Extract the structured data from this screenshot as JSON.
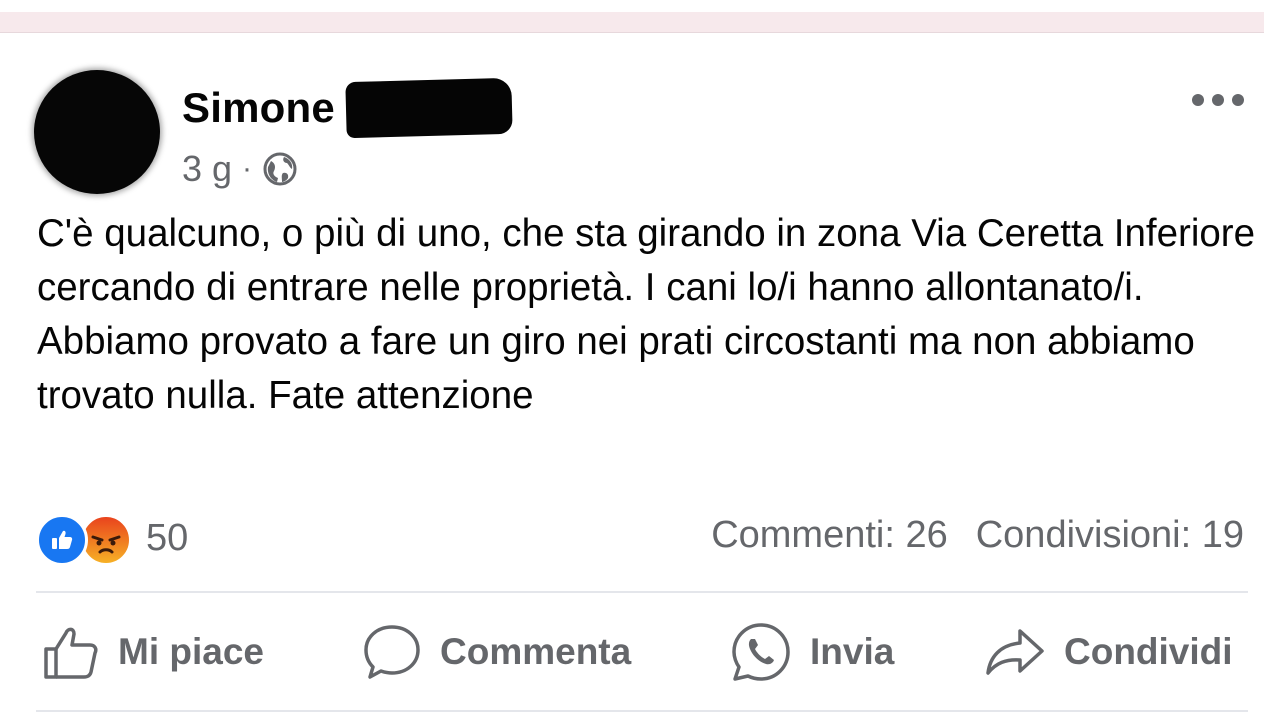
{
  "post": {
    "author_name": "Simone",
    "timestamp": "3 g",
    "separator": "·",
    "audience_icon": "globe-icon",
    "menu_icon": "more-options-icon",
    "text": "C'è qualcuno, o più di uno, che sta girando in zona Via Ceretta Inferiore cercando di entrare nelle proprietà. I cani lo/i hanno allontanato/i. Abbiamo provato a fare un giro nei prati circostanti ma non abbiamo trovato nulla. Fate attenzione"
  },
  "engagement": {
    "reaction_icons": [
      "like-reaction-icon",
      "angry-reaction-icon"
    ],
    "reaction_count": "50",
    "comments": "Commenti: 26",
    "shares": "Condivisioni: 19"
  },
  "actions": {
    "like": "Mi piace",
    "comment": "Commenta",
    "send": "Invia",
    "share": "Condividi"
  },
  "colors": {
    "text_primary": "#050505",
    "text_secondary": "#65676b",
    "like_blue": "#1877f2",
    "angry_orange": "#f07f22",
    "divider": "#e4e6eb"
  }
}
